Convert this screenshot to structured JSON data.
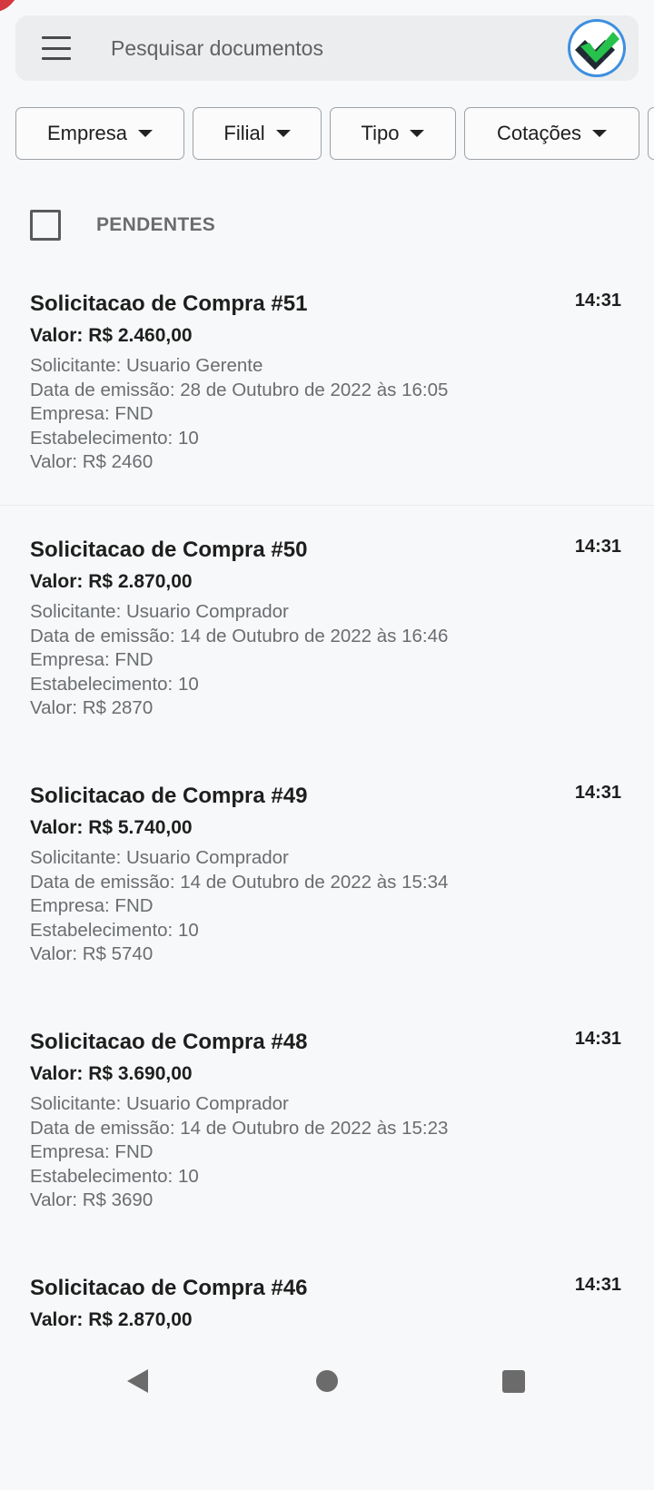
{
  "search": {
    "placeholder": "Pesquisar documentos"
  },
  "icons": {
    "menu": "hamburger-menu-icon",
    "avatar": "company-logo-avatar",
    "back": "triangle-back-icon",
    "home": "circle-home-icon",
    "recents": "square-recents-icon"
  },
  "filters": [
    {
      "label": "Empresa"
    },
    {
      "label": "Filial"
    },
    {
      "label": "Tipo"
    },
    {
      "label": "Cotações"
    }
  ],
  "pending": {
    "label": "PENDENTES"
  },
  "documents": [
    {
      "title": "Solicitacao de Compra #51",
      "time": "14:31",
      "value": "Valor: R$ 2.460,00",
      "requester": "Solicitante: Usuario Gerente",
      "issue_date": "Data de emissão: 28 de Outubro de 2022 às 16:05",
      "company": "Empresa: FND",
      "establishment": "Estabelecimento: 10",
      "raw_value": "Valor: R$ 2460"
    },
    {
      "title": "Solicitacao de Compra #50",
      "time": "14:31",
      "value": "Valor: R$ 2.870,00",
      "requester": "Solicitante: Usuario Comprador",
      "issue_date": "Data de emissão: 14 de Outubro de 2022 às 16:46",
      "company": "Empresa: FND",
      "establishment": "Estabelecimento: 10",
      "raw_value": "Valor: R$ 2870"
    },
    {
      "title": "Solicitacao de Compra #49",
      "time": "14:31",
      "value": "Valor: R$ 5.740,00",
      "requester": "Solicitante: Usuario Comprador",
      "issue_date": "Data de emissão: 14 de Outubro de 2022 às 15:34",
      "company": "Empresa: FND",
      "establishment": "Estabelecimento: 10",
      "raw_value": "Valor: R$ 5740"
    },
    {
      "title": "Solicitacao de Compra #48",
      "time": "14:31",
      "value": "Valor: R$ 3.690,00",
      "requester": "Solicitante: Usuario Comprador",
      "issue_date": "Data de emissão: 14 de Outubro de 2022 às 15:23",
      "company": "Empresa: FND",
      "establishment": "Estabelecimento: 10",
      "raw_value": "Valor: R$ 3690"
    },
    {
      "title": "Solicitacao de Compra #46",
      "time": "14:31",
      "value": "Valor: R$ 2.870,00"
    }
  ],
  "colors": {
    "background": "#f7f8f9",
    "search_bar": "#ebedef",
    "avatar_ring": "#3d8fe0",
    "logo_green": "#27c24c",
    "logo_dark": "#1f2a33",
    "secondary_text": "#6a6d70",
    "corner_accent": "#d3393f"
  }
}
